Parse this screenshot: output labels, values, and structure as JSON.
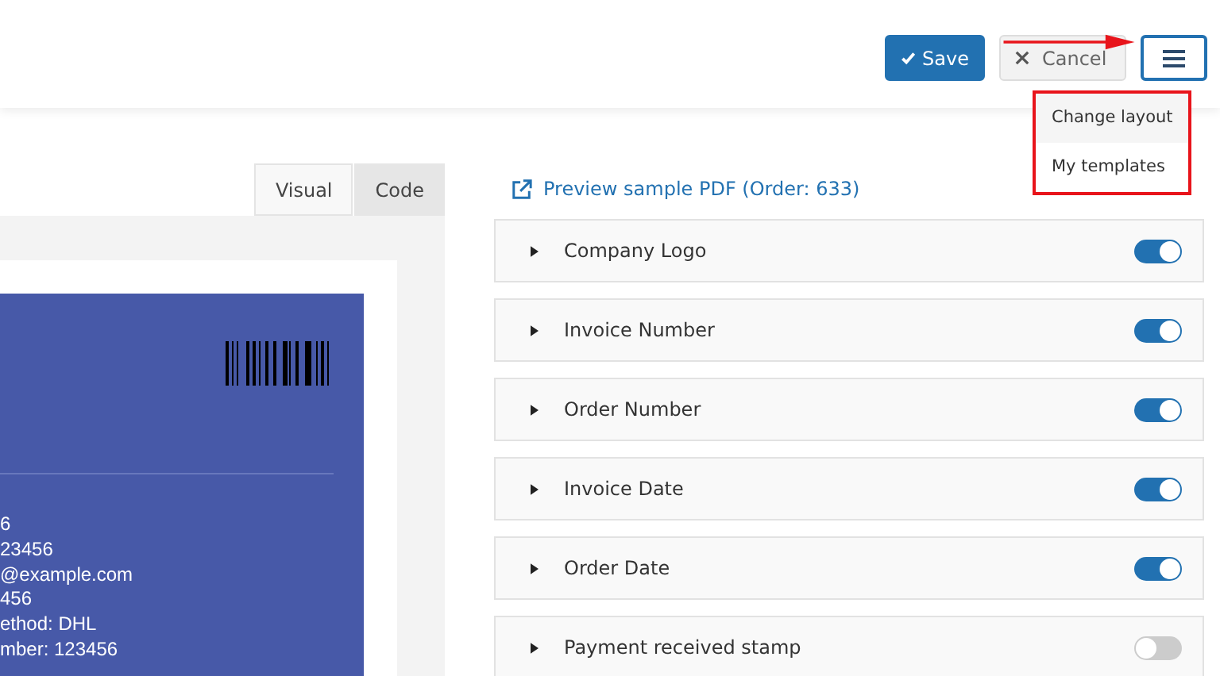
{
  "header": {
    "save_button": "Save",
    "cancel_button": "Cancel",
    "menu_open": true,
    "menu": [
      {
        "label": "Change layout",
        "selected": true
      },
      {
        "label": "My templates",
        "selected": false
      }
    ]
  },
  "editor_tabs": [
    {
      "label": "Visual",
      "selected": true
    },
    {
      "label": "Code",
      "selected": false
    }
  ],
  "preview": {
    "lines": [
      "6",
      "23456",
      "@example.com",
      "456",
      "ethod: DHL",
      "mber: 123456"
    ]
  },
  "preview_link": "Preview sample PDF (Order: 633)",
  "sections": [
    {
      "label": "Company Logo",
      "on": true
    },
    {
      "label": "Invoice Number",
      "on": true
    },
    {
      "label": "Order Number",
      "on": true
    },
    {
      "label": "Invoice Date",
      "on": true
    },
    {
      "label": "Order Date",
      "on": true
    },
    {
      "label": "Payment received stamp",
      "on": false
    }
  ]
}
